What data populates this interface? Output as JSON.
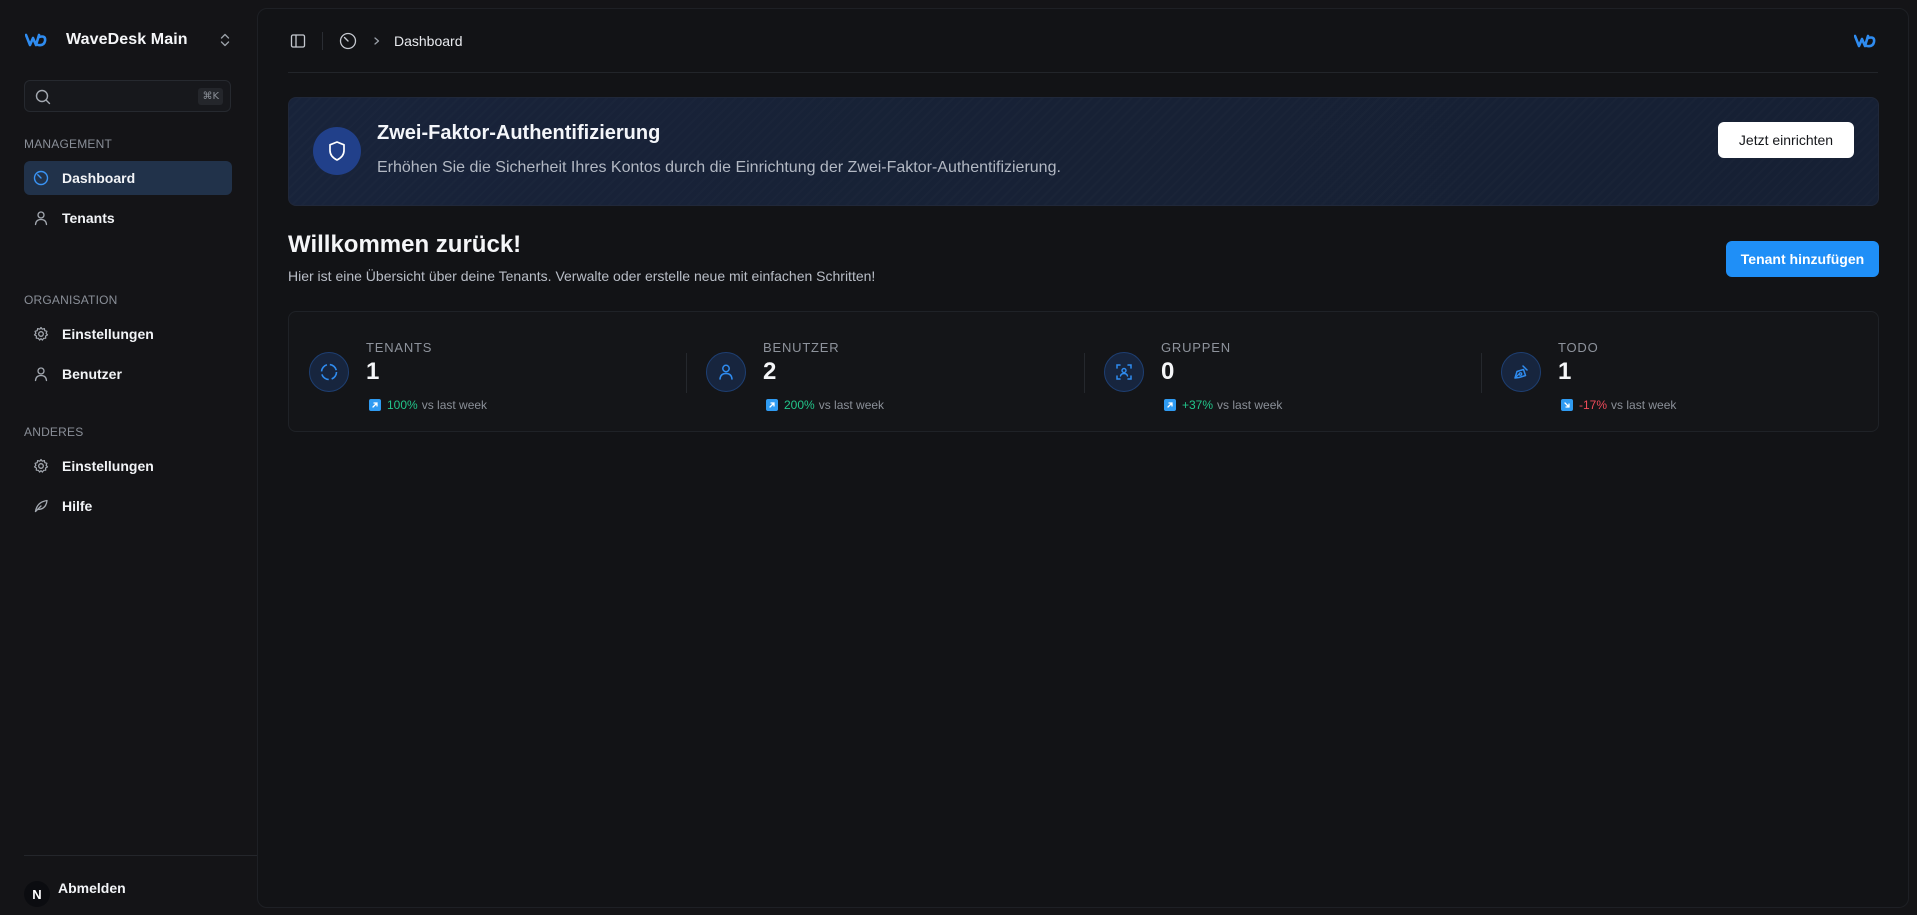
{
  "sidebar": {
    "workspace_name": "WaveDesk Main",
    "search": {
      "placeholder": "",
      "shortcut": "⌘K"
    },
    "sections": [
      {
        "label": "MANAGEMENT",
        "items": [
          {
            "label": "Dashboard",
            "icon": "gauge-icon",
            "active": true
          },
          {
            "label": "Tenants",
            "icon": "user-icon"
          }
        ]
      },
      {
        "label": "ORGANISATION",
        "items": [
          {
            "label": "Einstellungen",
            "icon": "gear-icon"
          },
          {
            "label": "Benutzer",
            "icon": "user-icon"
          }
        ]
      },
      {
        "label": "ANDERES",
        "items": [
          {
            "label": "Einstellungen",
            "icon": "gear-icon"
          },
          {
            "label": "Hilfe",
            "icon": "leaf-icon"
          }
        ]
      }
    ],
    "logout": {
      "avatar_initial": "N",
      "label": "Abmelden"
    }
  },
  "topbar": {
    "breadcrumb": "Dashboard"
  },
  "banner": {
    "title": "Zwei-Faktor-Authentifizierung",
    "description": "Erhöhen Sie die Sicherheit Ihres Kontos durch die Einrichtung der Zwei-Faktor-Authentifizierung.",
    "button_label": "Jetzt einrichten"
  },
  "welcome": {
    "title": "Willkommen zurück!",
    "subtitle": "Hier ist eine Übersicht über deine Tenants. Verwalte oder erstelle neue mit einfachen Schritten!",
    "add_button": "Tenant hinzufügen"
  },
  "stats": [
    {
      "label": "TENANTS",
      "value": "1",
      "trend": "100%",
      "trend_direction": "up",
      "trend_text": "vs last week",
      "icon": "refresh-circle-icon"
    },
    {
      "label": "BENUTZER",
      "value": "2",
      "trend": "200%",
      "trend_direction": "up",
      "trend_text": "vs last week",
      "icon": "user-icon"
    },
    {
      "label": "GRUPPEN",
      "value": "0",
      "trend": "+37%",
      "trend_direction": "up",
      "trend_text": "vs last week",
      "icon": "group-scan-icon"
    },
    {
      "label": "TODO",
      "value": "1",
      "trend": "-17%",
      "trend_direction": "down",
      "trend_text": "vs last week",
      "icon": "pen-tool-icon"
    }
  ],
  "colors": {
    "accent": "#1f8ff7",
    "active_nav": "#21324a",
    "positive": "#22c58a",
    "negative": "#ef4b5a"
  }
}
